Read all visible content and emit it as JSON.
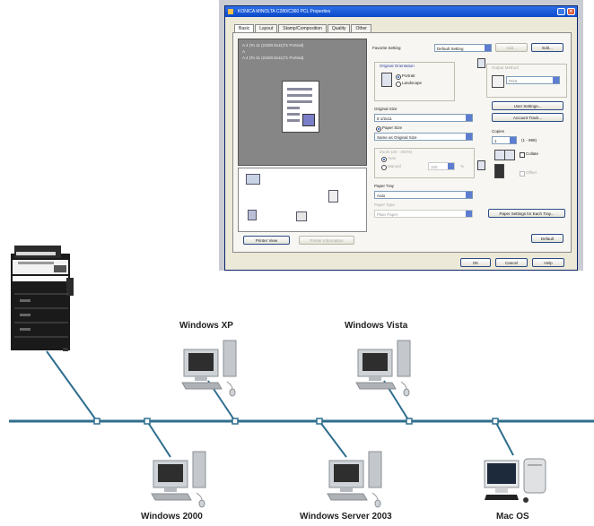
{
  "dialog": {
    "title": "KONICA MINOLTA C280/C360 PCL Properties",
    "tabs": [
      "Basic",
      "Layout",
      "Stamp/Composition",
      "Quality",
      "Other"
    ],
    "preview_lines": [
      "A 4 (To 11 (210/8.5x11)71 Portrait)",
      "A",
      "A 4 (To 11 (210/8.5x11)71 Portrait)"
    ],
    "favorite_setting_label": "Favorite Setting",
    "favorite_setting_value": "Default Setting",
    "add_label": "Add...",
    "edit_label": "Edit...",
    "original_orientation_label": "Original Orientation",
    "portrait_label": "Portrait",
    "landscape_label": "Landscape",
    "output_method_label": "Output Method",
    "output_method_value": "Print",
    "original_size_label": "Original Size",
    "original_size_value": "8 1/2x11",
    "paper_size_label": "Paper Size",
    "paper_size_value": "Same as Original Size",
    "zoom_label": "Zoom (25 - 400%)",
    "zoom_auto": "Auto",
    "zoom_manual": "Manual",
    "zoom_value": "100",
    "percent": "%",
    "user_settings_label": "User Settings...",
    "account_track_label": "Account Track...",
    "copies_label": "Copies",
    "copies_value": "1",
    "copies_range": "(1 - 999)",
    "collate_label": "Collate",
    "offset_label": "Offset",
    "paper_tray_label": "Paper Tray",
    "paper_tray_value": "Auto",
    "paper_type_label": "Paper Type",
    "paper_type_value": "Plain Paper",
    "paper_settings_label": "Paper Settings for Each Tray...",
    "default_label": "Default",
    "printer_view_label": "Printer View",
    "printer_information_label": "Printer Information",
    "ok_label": "OK",
    "cancel_label": "Cancel",
    "help_label": "Help"
  },
  "network": {
    "line_color": "#2e6e8e",
    "clients": [
      {
        "name": "Windows XP"
      },
      {
        "name": "Windows Vista"
      },
      {
        "name": "Windows 2000"
      },
      {
        "name": "Windows Server 2003"
      },
      {
        "name": "Mac OS"
      }
    ]
  }
}
